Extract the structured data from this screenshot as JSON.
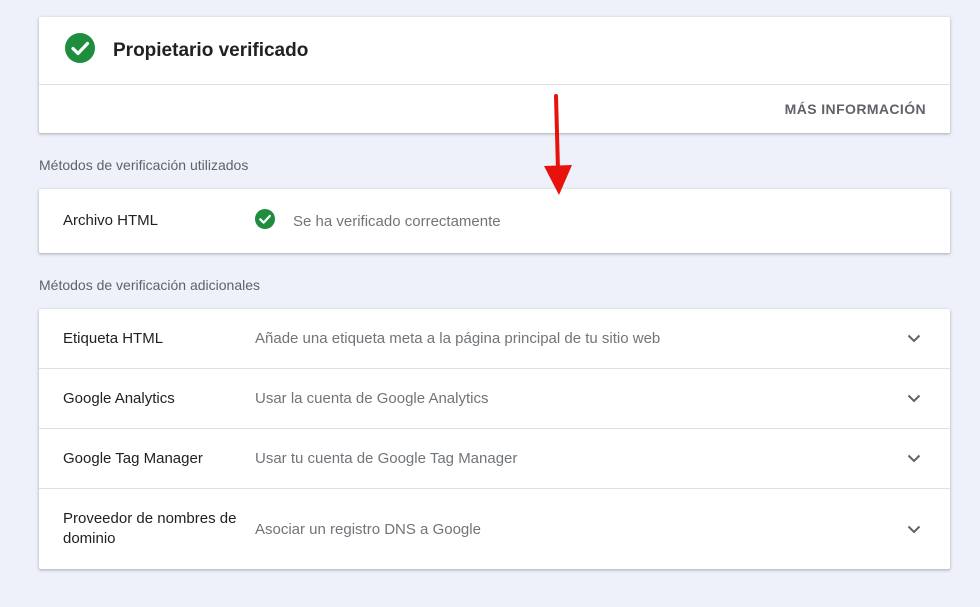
{
  "owner": {
    "title": "Propietario verificado",
    "more_label": "MÁS INFORMACIÓN",
    "icon": "check-circle-icon"
  },
  "used_methods": {
    "section_label": "Métodos de verificación utilizados",
    "items": [
      {
        "name": "Archivo HTML",
        "status": "Se ha verificado correctamente",
        "icon": "check-circle-icon"
      }
    ]
  },
  "additional_methods": {
    "section_label": "Métodos de verificación adicionales",
    "items": [
      {
        "name": "Etiqueta HTML",
        "description": "Añade una etiqueta meta a la página principal de tu sitio web",
        "icon": "chevron-down-icon"
      },
      {
        "name": "Google Analytics",
        "description": "Usar la cuenta de Google Analytics",
        "icon": "chevron-down-icon"
      },
      {
        "name": "Google Tag Manager",
        "description": "Usar tu cuenta de Google Tag Manager",
        "icon": "chevron-down-icon"
      },
      {
        "name": "Proveedor de nombres de dominio",
        "description": "Asociar un registro DNS a Google",
        "icon": "chevron-down-icon"
      }
    ]
  },
  "colors": {
    "success": "#1e8e3e",
    "annotation_arrow": "#e8120c",
    "background": "#eef1fa"
  }
}
